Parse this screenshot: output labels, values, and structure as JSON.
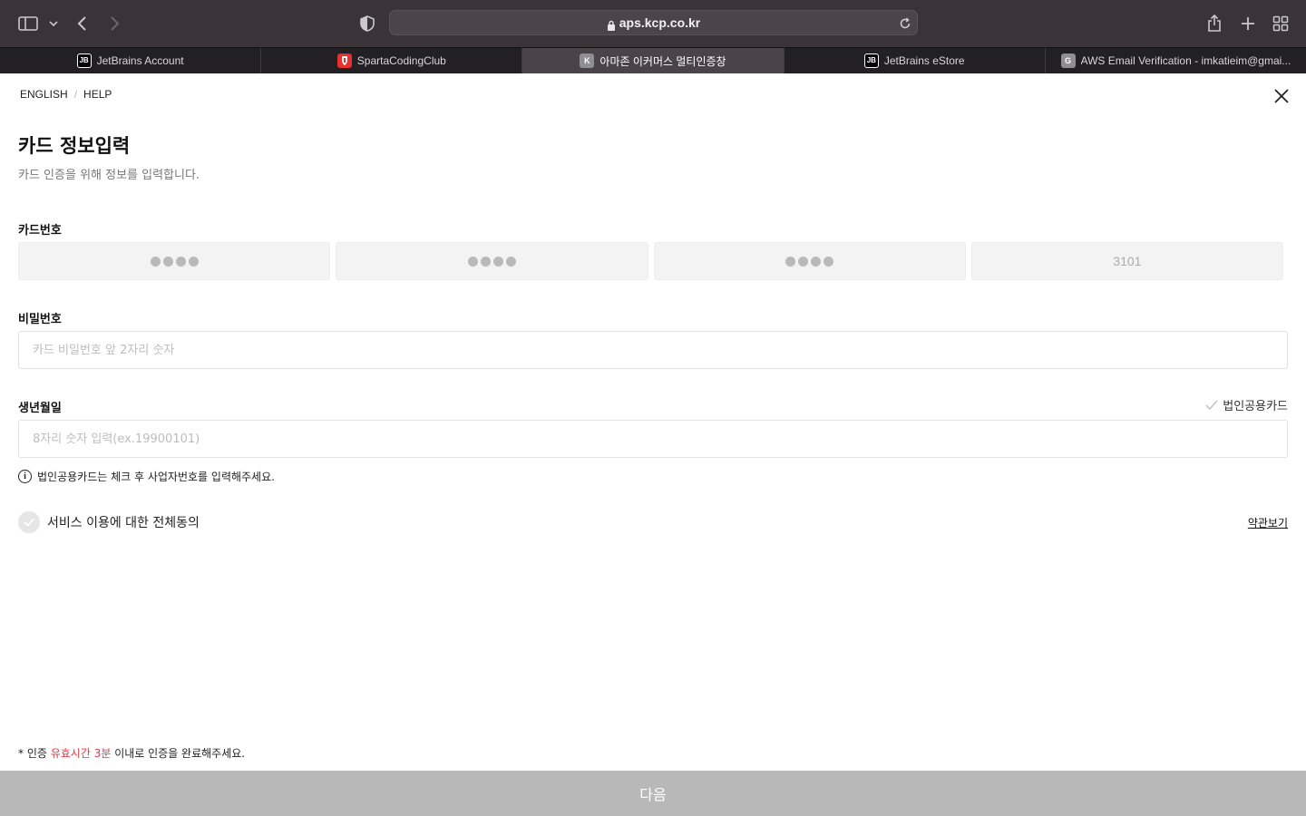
{
  "browser": {
    "url": "aps.kcp.co.kr",
    "tabs": [
      {
        "label": "JetBrains Account",
        "favicon": "JB"
      },
      {
        "label": "SpartaCodingClub",
        "favicon": "sparta-icon"
      },
      {
        "label": "아마존 이커머스 멀티인증창",
        "favicon": "K",
        "active": true
      },
      {
        "label": "JetBrains eStore",
        "favicon": "JB"
      },
      {
        "label": "AWS Email Verification - imkatieim@gmai...",
        "favicon": "G"
      }
    ]
  },
  "topnav": {
    "english": "ENGLISH",
    "separator": "/",
    "help": "HELP"
  },
  "form": {
    "title": "카드 정보입력",
    "subtitle": "카드 인증을 위해 정보를 입력합니다.",
    "card_number": {
      "label": "카드번호",
      "last_digits": "3101"
    },
    "password": {
      "label": "비밀번호",
      "placeholder": "카드 비밀번호 앞 2자리 숫자"
    },
    "birthdate": {
      "label": "생년월일",
      "placeholder": "8자리 숫자 입력(ex.19900101)",
      "corporate_card_label": "법인공용카드"
    },
    "info_text": "법인공용카드는 체크 후 사업자번호를 입력해주세요.",
    "agree_all": "서비스 이용에 대한 전체동의",
    "terms_link": "약관보기"
  },
  "notice": {
    "prefix": "* 인증 ",
    "highlight": "유효시간 3분",
    "suffix": " 이내로 인증을 완료해주세요."
  },
  "next_button": "다음",
  "colors": {
    "accent_red": "#e83540",
    "button_disabled": "#b8b8b8",
    "chrome_dark": "#3a3438"
  }
}
